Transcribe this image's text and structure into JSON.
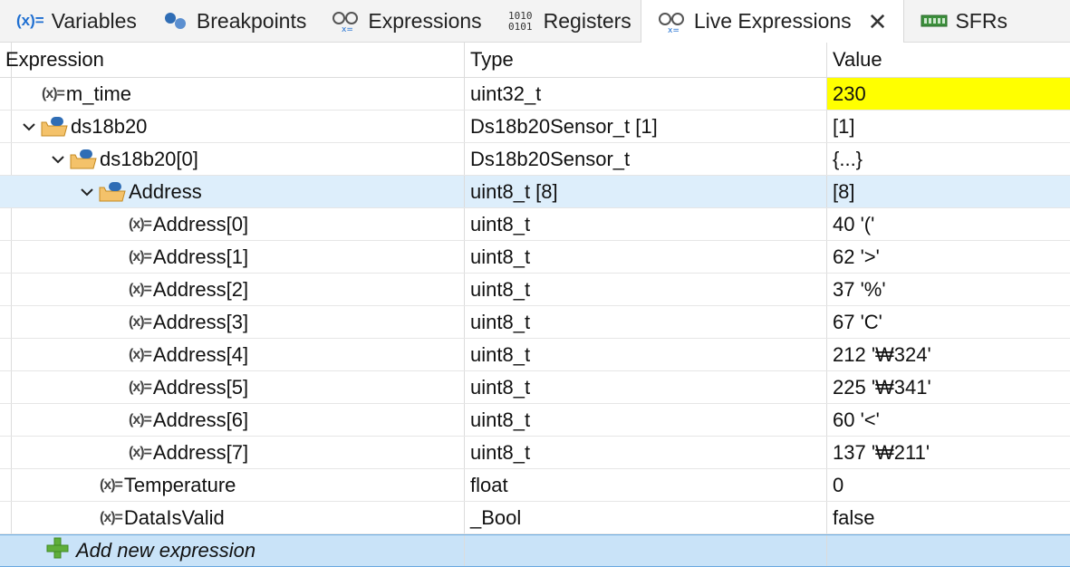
{
  "tabs": [
    {
      "label": "Variables",
      "icon": "variables-icon"
    },
    {
      "label": "Breakpoints",
      "icon": "breakpoints-icon"
    },
    {
      "label": "Expressions",
      "icon": "expressions-icon"
    },
    {
      "label": "Registers",
      "icon": "registers-icon"
    },
    {
      "label": "Live Expressions",
      "icon": "live-expressions-icon",
      "active": true
    },
    {
      "label": "SFRs",
      "icon": "sfrs-icon"
    }
  ],
  "columns": {
    "expression": "Expression",
    "type": "Type",
    "value": "Value"
  },
  "rows": [
    {
      "name": "m_time",
      "type": "uint32_t",
      "value": "230",
      "icon": "variable-icon",
      "highlight": "#ffff00"
    },
    {
      "name": "ds18b20",
      "type": "Ds18b20Sensor_t [1]",
      "value": "[1]",
      "icon": "folder-icon",
      "expanded": true
    },
    {
      "name": "ds18b20[0]",
      "type": "Ds18b20Sensor_t",
      "value": "{...}",
      "icon": "folder-icon",
      "expanded": true
    },
    {
      "name": "Address",
      "type": "uint8_t [8]",
      "value": "[8]",
      "icon": "folder-icon",
      "expanded": true,
      "selected": true
    },
    {
      "name": "Address[0]",
      "type": "uint8_t",
      "value": "40 '('",
      "icon": "variable-icon"
    },
    {
      "name": "Address[1]",
      "type": "uint8_t",
      "value": "62 '>'",
      "icon": "variable-icon"
    },
    {
      "name": "Address[2]",
      "type": "uint8_t",
      "value": "37 '%'",
      "icon": "variable-icon"
    },
    {
      "name": "Address[3]",
      "type": "uint8_t",
      "value": "67 'C'",
      "icon": "variable-icon"
    },
    {
      "name": "Address[4]",
      "type": "uint8_t",
      "value": "212 '₩324'",
      "icon": "variable-icon"
    },
    {
      "name": "Address[5]",
      "type": "uint8_t",
      "value": "225 '₩341'",
      "icon": "variable-icon"
    },
    {
      "name": "Address[6]",
      "type": "uint8_t",
      "value": "60 '<'",
      "icon": "variable-icon"
    },
    {
      "name": "Address[7]",
      "type": "uint8_t",
      "value": "137 '₩211'",
      "icon": "variable-icon"
    },
    {
      "name": "Temperature",
      "type": "float",
      "value": "0",
      "icon": "variable-icon"
    },
    {
      "name": "DataIsValid",
      "type": "_Bool",
      "value": "false",
      "icon": "variable-icon"
    }
  ],
  "add_row": {
    "label": "Add new expression",
    "icon": "plus-icon"
  },
  "icon_texts": {
    "var": "(x)=",
    "registers": "1010\n0101"
  },
  "colors": {
    "highlight": "#ffff00",
    "selected_row": "#ddeefb",
    "add_row": "#c9e3f8"
  }
}
